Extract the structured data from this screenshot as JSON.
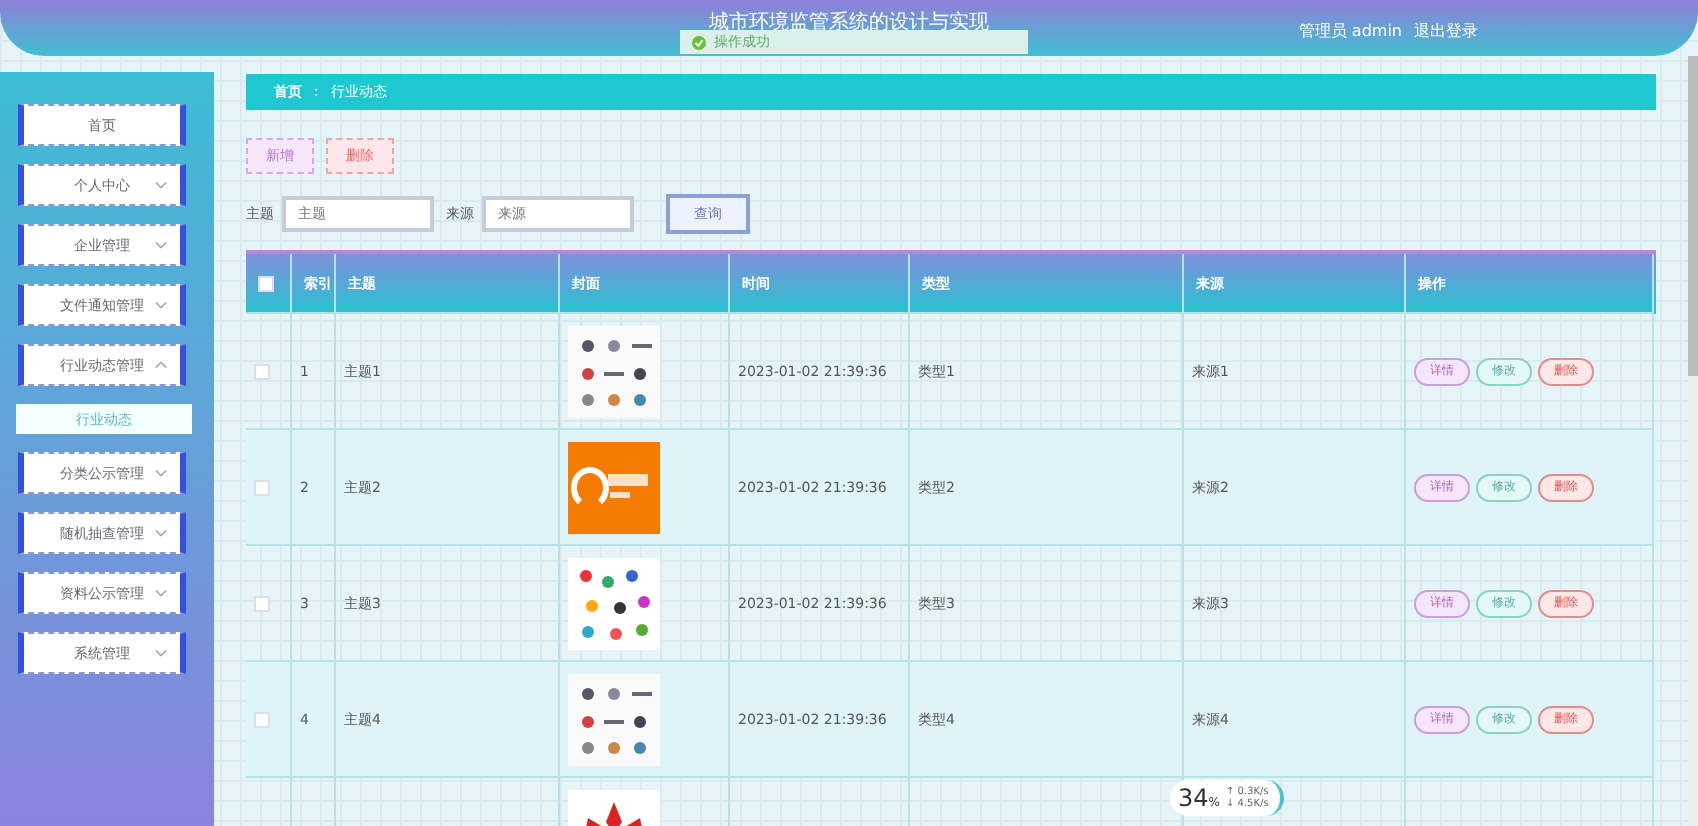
{
  "header": {
    "title": "城市环境监管系统的设计与实现",
    "user": "管理员 admin",
    "logout": "退出登录"
  },
  "toast": {
    "message": "操作成功"
  },
  "sidebar": {
    "items": [
      {
        "label": "首页",
        "kind": "link"
      },
      {
        "label": "个人中心",
        "kind": "menu",
        "expanded": false
      },
      {
        "label": "企业管理",
        "kind": "menu",
        "expanded": false
      },
      {
        "label": "文件通知管理",
        "kind": "menu",
        "expanded": false
      },
      {
        "label": "行业动态管理",
        "kind": "menu",
        "expanded": true,
        "children": [
          {
            "label": "行业动态",
            "selected": true
          }
        ]
      },
      {
        "label": "分类公示管理",
        "kind": "menu",
        "expanded": false
      },
      {
        "label": "随机抽查管理",
        "kind": "menu",
        "expanded": false
      },
      {
        "label": "资料公示管理",
        "kind": "menu",
        "expanded": false
      },
      {
        "label": "系统管理",
        "kind": "menu",
        "expanded": false
      }
    ]
  },
  "breadcrumb": {
    "separator": ":",
    "items": [
      "首页",
      "行业动态"
    ]
  },
  "actions": [
    "新增",
    "删除"
  ],
  "search": {
    "fields": [
      {
        "label": "主题",
        "placeholder": "主题"
      },
      {
        "label": "来源",
        "placeholder": "来源"
      }
    ],
    "button": "查询"
  },
  "table": {
    "header_checked": false,
    "columns": [
      "索引",
      "主题",
      "封面",
      "时间",
      "类型",
      "来源",
      "操作"
    ],
    "rows": [
      {
        "kind": "full",
        "checked": false,
        "index": "1",
        "title": "主题1",
        "time": "2023-01-02 21:39:36",
        "type": "类型1",
        "source": "来源1",
        "buttons": [
          "详情",
          "修改",
          "删除"
        ]
      },
      {
        "kind": "full",
        "checked": false,
        "index": "2",
        "title": "主题2",
        "time": "2023-01-02 21:39:36",
        "type": "类型2",
        "source": "来源2",
        "buttons": [
          "详情",
          "修改",
          "删除"
        ]
      },
      {
        "kind": "full",
        "checked": false,
        "index": "3",
        "title": "主题3",
        "time": "2023-01-02 21:39:36",
        "type": "类型3",
        "source": "来源3",
        "buttons": [
          "详情",
          "修改",
          "删除"
        ]
      },
      {
        "kind": "full",
        "checked": false,
        "index": "4",
        "title": "主题4",
        "time": "2023-01-02 21:39:36",
        "type": "类型4",
        "source": "来源4",
        "buttons": [
          "详情",
          "修改",
          "删除"
        ]
      },
      {
        "kind": "cut"
      }
    ]
  },
  "speed_widget": {
    "percent": "34",
    "unit": "%",
    "up": "↑ 0.3K/s",
    "down": "↓ 4.5K/s"
  }
}
